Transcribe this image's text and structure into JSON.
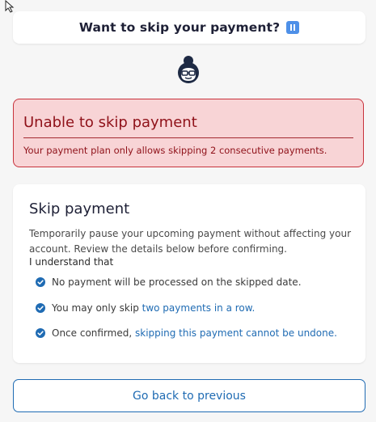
{
  "header": {
    "title": "Want to skip your payment?",
    "icon": "pause-icon"
  },
  "avatar": {
    "icon": "support-agent-avatar-icon"
  },
  "alert": {
    "title": "Unable to skip payment",
    "message": "Your payment plan only allows skipping 2 consecutive payments.",
    "background": "#f8d4d6",
    "border_color": "#c8333c",
    "text_color": "#8f1119"
  },
  "skip_card": {
    "title": "Skip payment",
    "description": "Temporarily pause your upcoming payment without affecting your account. Review the details below before confirming.",
    "understand_label": "I understand that",
    "points": [
      {
        "text": "No payment will be processed on the skipped date.",
        "link": ""
      },
      {
        "text": "You may only skip ",
        "link": "two payments in a row."
      },
      {
        "text": "Once confirmed, ",
        "link": "skipping this payment cannot be undone."
      }
    ],
    "check_color": "#1f6bb3"
  },
  "back_button": {
    "label": "Go back to previous",
    "color": "#1f6bb3"
  }
}
